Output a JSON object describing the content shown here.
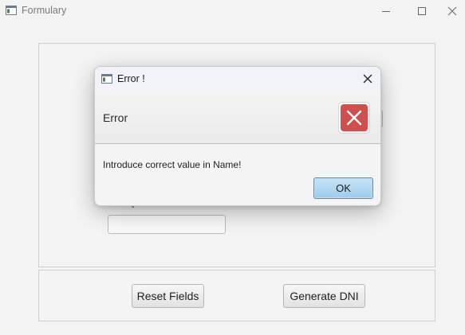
{
  "window": {
    "title": "Formulary"
  },
  "form": {
    "reset_label": "Reset Fields",
    "generate_label": "Generate DNI"
  },
  "dialog": {
    "title": "Error !",
    "header_text": "Error",
    "content_text": "Introduce correct value in Name!",
    "ok_label": "OK"
  },
  "colors": {
    "error_badge": "#cf4f4f",
    "ok_button_border": "#3f95d6",
    "ok_button_fill": "#aed5ef"
  },
  "icons": {
    "app": "app-window-icon",
    "minimize": "minimize-icon",
    "maximize": "maximize-icon",
    "close": "close-icon",
    "error": "error-x-icon"
  }
}
